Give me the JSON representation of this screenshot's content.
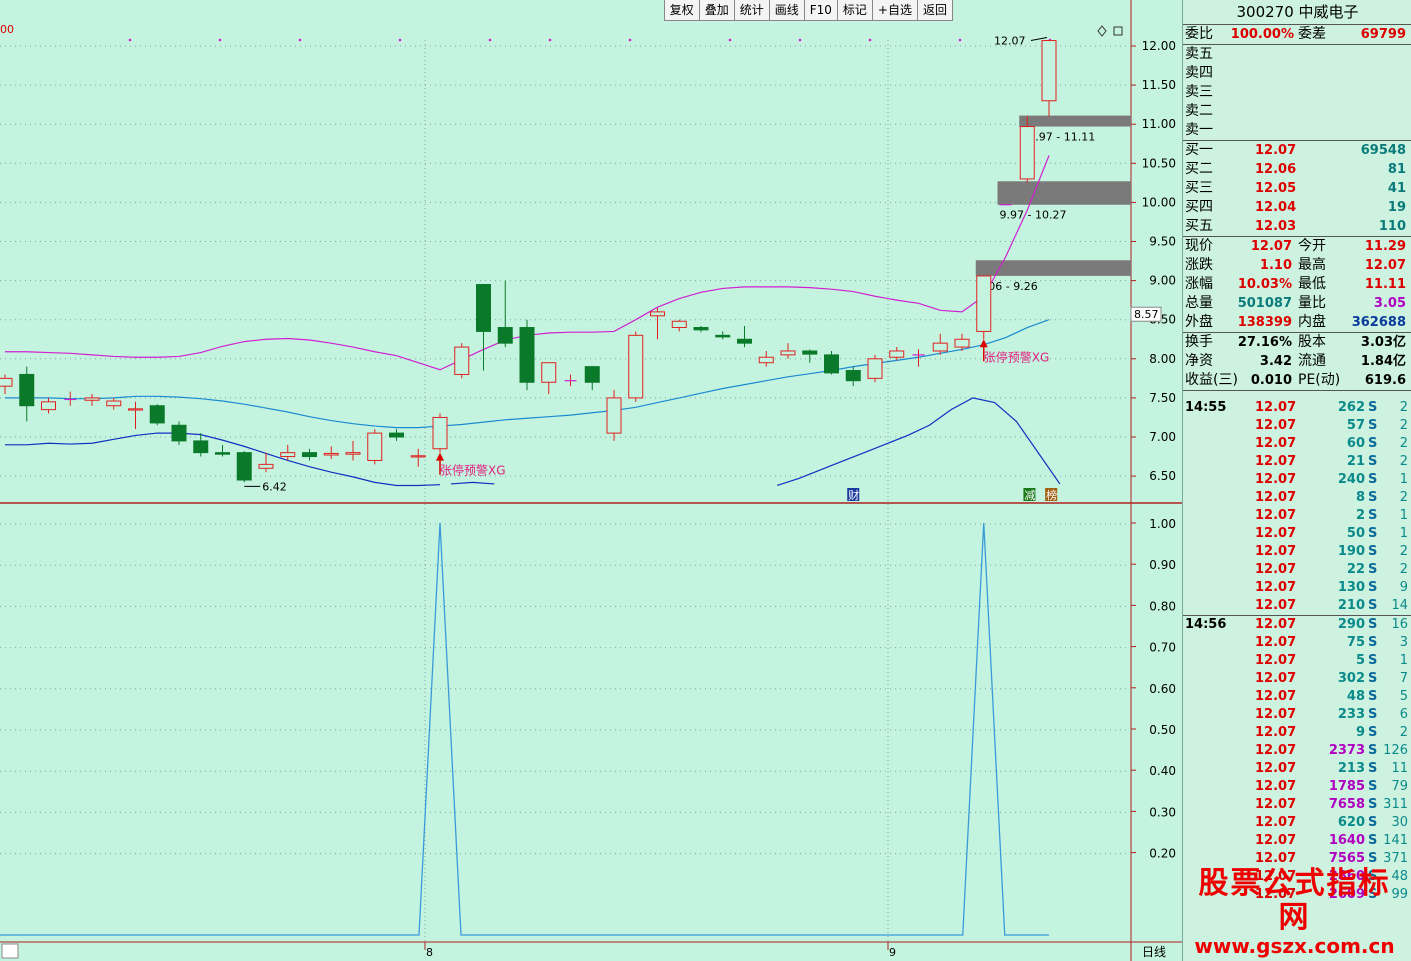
{
  "toolbar": [
    "复权",
    "叠加",
    "统计",
    "画线",
    "F10",
    "标记",
    "+自选",
    "返回"
  ],
  "chart_data": [
    {
      "type": "candlestick",
      "yticks": [
        12.0,
        11.5,
        11.0,
        10.5,
        10.0,
        9.5,
        9.0,
        8.5,
        8.0,
        7.5,
        7.0,
        6.5
      ],
      "ylim": [
        6.2,
        12.2
      ],
      "current_price_label": "8.57",
      "candles": [
        {
          "o": 7.65,
          "h": 7.8,
          "l": 7.55,
          "c": 7.75
        },
        {
          "o": 7.8,
          "h": 7.9,
          "l": 7.2,
          "c": 7.4
        },
        {
          "o": 7.35,
          "h": 7.5,
          "l": 7.3,
          "c": 7.45
        },
        {
          "o": 7.48,
          "h": 7.58,
          "l": 7.4,
          "c": 7.48
        },
        {
          "o": 7.47,
          "h": 7.55,
          "l": 7.4,
          "c": 7.5
        },
        {
          "o": 7.4,
          "h": 7.5,
          "l": 7.35,
          "c": 7.46
        },
        {
          "o": 7.35,
          "h": 7.45,
          "l": 7.1,
          "c": 7.36
        },
        {
          "o": 7.4,
          "h": 7.42,
          "l": 7.15,
          "c": 7.18
        },
        {
          "o": 7.15,
          "h": 7.2,
          "l": 6.9,
          "c": 6.95
        },
        {
          "o": 6.95,
          "h": 7.05,
          "l": 6.75,
          "c": 6.8
        },
        {
          "o": 6.8,
          "h": 6.9,
          "l": 6.75,
          "c": 6.78
        },
        {
          "o": 6.8,
          "h": 6.82,
          "l": 6.42,
          "c": 6.45
        },
        {
          "o": 6.6,
          "h": 6.8,
          "l": 6.55,
          "c": 6.65
        },
        {
          "o": 6.75,
          "h": 6.9,
          "l": 6.7,
          "c": 6.8
        },
        {
          "o": 6.8,
          "h": 6.85,
          "l": 6.7,
          "c": 6.75
        },
        {
          "o": 6.77,
          "h": 6.88,
          "l": 6.72,
          "c": 6.79
        },
        {
          "o": 6.78,
          "h": 6.95,
          "l": 6.7,
          "c": 6.8
        },
        {
          "o": 6.7,
          "h": 7.1,
          "l": 6.65,
          "c": 7.05
        },
        {
          "o": 7.05,
          "h": 7.1,
          "l": 6.95,
          "c": 7.0
        },
        {
          "o": 6.75,
          "h": 6.85,
          "l": 6.62,
          "c": 6.76
        },
        {
          "o": 6.85,
          "h": 7.3,
          "l": 6.8,
          "c": 7.25
        },
        {
          "o": 7.8,
          "h": 8.2,
          "l": 7.75,
          "c": 8.15
        },
        {
          "o": 8.95,
          "h": 8.95,
          "l": 7.85,
          "c": 8.35
        },
        {
          "o": 8.4,
          "h": 9.0,
          "l": 8.15,
          "c": 8.2
        },
        {
          "o": 8.4,
          "h": 8.5,
          "l": 7.6,
          "c": 7.7
        },
        {
          "o": 7.7,
          "h": 7.95,
          "l": 7.55,
          "c": 7.95
        },
        {
          "o": 7.72,
          "h": 7.8,
          "l": 7.65,
          "c": 7.72
        },
        {
          "o": 7.9,
          "h": 7.9,
          "l": 7.6,
          "c": 7.7
        },
        {
          "o": 7.05,
          "h": 7.6,
          "l": 6.95,
          "c": 7.5
        },
        {
          "o": 7.5,
          "h": 8.35,
          "l": 7.45,
          "c": 8.3
        },
        {
          "o": 8.55,
          "h": 8.65,
          "l": 8.25,
          "c": 8.6
        },
        {
          "o": 8.4,
          "h": 8.5,
          "l": 8.35,
          "c": 8.48
        },
        {
          "o": 8.4,
          "h": 8.42,
          "l": 8.34,
          "c": 8.37
        },
        {
          "o": 8.3,
          "h": 8.35,
          "l": 8.25,
          "c": 8.28
        },
        {
          "o": 8.25,
          "h": 8.42,
          "l": 8.15,
          "c": 8.2
        },
        {
          "o": 7.95,
          "h": 8.1,
          "l": 7.9,
          "c": 8.02
        },
        {
          "o": 8.05,
          "h": 8.2,
          "l": 8.0,
          "c": 8.1
        },
        {
          "o": 8.1,
          "h": 8.12,
          "l": 7.95,
          "c": 8.06
        },
        {
          "o": 8.05,
          "h": 8.1,
          "l": 7.8,
          "c": 7.82
        },
        {
          "o": 7.85,
          "h": 7.9,
          "l": 7.65,
          "c": 7.72
        },
        {
          "o": 7.75,
          "h": 8.05,
          "l": 7.7,
          "c": 8.0
        },
        {
          "o": 8.02,
          "h": 8.15,
          "l": 7.98,
          "c": 8.1
        },
        {
          "o": 8.05,
          "h": 8.12,
          "l": 7.9,
          "c": 8.05
        },
        {
          "o": 8.1,
          "h": 8.32,
          "l": 8.05,
          "c": 8.2
        },
        {
          "o": 8.15,
          "h": 8.32,
          "l": 8.1,
          "c": 8.25
        },
        {
          "o": 8.35,
          "h": 9.07,
          "l": 8.25,
          "c": 9.06
        },
        {
          "o": 9.97,
          "h": 9.97,
          "l": 9.97,
          "c": 9.97
        },
        {
          "o": 10.3,
          "h": 11.11,
          "l": 10.25,
          "c": 10.97
        },
        {
          "o": 11.3,
          "h": 12.07,
          "l": 11.1,
          "c": 12.07
        }
      ],
      "boll_upper": [
        8.09,
        8.09,
        8.08,
        8.07,
        8.05,
        8.03,
        8.02,
        8.02,
        8.03,
        8.08,
        8.16,
        8.22,
        8.25,
        8.26,
        8.24,
        8.2,
        8.15,
        8.09,
        8.04,
        7.95,
        7.86,
        7.99,
        8.12,
        8.24,
        8.3,
        8.33,
        8.34,
        8.34,
        8.35,
        8.5,
        8.66,
        8.77,
        8.85,
        8.9,
        8.92,
        8.92,
        8.92,
        8.91,
        8.89,
        8.86,
        8.8,
        8.75,
        8.71,
        8.62,
        8.6,
        8.8,
        9.3,
        9.9,
        10.6
      ],
      "boll_mid": [
        7.5,
        7.5,
        7.5,
        7.49,
        7.49,
        7.5,
        7.52,
        7.52,
        7.51,
        7.49,
        7.46,
        7.42,
        7.37,
        7.32,
        7.26,
        7.21,
        7.17,
        7.14,
        7.12,
        7.12,
        7.14,
        7.16,
        7.19,
        7.22,
        7.24,
        7.26,
        7.28,
        7.31,
        7.34,
        7.38,
        7.44,
        7.5,
        7.56,
        7.62,
        7.67,
        7.72,
        7.77,
        7.81,
        7.85,
        7.9,
        7.94,
        7.98,
        8.02,
        8.07,
        8.12,
        8.18,
        8.27,
        8.4,
        8.5
      ],
      "boll_lower_segments": [
        [
          6.9,
          6.9,
          6.92,
          6.91,
          6.92,
          6.97,
          7.02,
          7.05,
          7.05,
          7.03,
          6.96,
          6.88,
          6.79,
          6.7,
          6.62,
          6.55,
          6.49,
          6.42,
          6.38,
          6.38,
          6.39
        ],
        [
          6.4,
          6.42,
          6.4
        ],
        [
          6.38,
          6.47,
          6.58,
          6.69,
          6.8,
          6.91,
          7.02,
          7.15,
          7.35,
          7.5,
          7.44,
          7.2,
          6.8,
          6.4
        ]
      ],
      "markers": [
        {
          "text": "张停预警XG",
          "candle": 20
        },
        {
          "text": "张停预警XG",
          "candle": 45
        }
      ],
      "gap_zones": [
        {
          "from": 10.97,
          "to": 11.11,
          "label": "10.97 - 11.11"
        },
        {
          "from": 9.97,
          "to": 10.27,
          "label": "9.97 - 10.27"
        },
        {
          "from": 9.06,
          "to": 9.26,
          "label": "9.06 - 9.26"
        }
      ],
      "annotations": {
        "high_label": "12.07",
        "low_label": "6.42"
      },
      "badges": [
        "财",
        "减",
        "榜"
      ],
      "x_labels": [
        "8",
        "9"
      ],
      "corner_label": "00"
    },
    {
      "type": "line",
      "yticks": [
        1.0,
        0.9,
        0.8,
        0.7,
        0.6,
        0.5,
        0.4,
        0.3,
        0.2
      ],
      "ylim": [
        0,
        1
      ],
      "spikes_at_candles": [
        20,
        45
      ]
    }
  ],
  "period_label": "日线",
  "panel": {
    "title": "300270 中威电子",
    "wei_bi": {
      "label": "委比",
      "value": "100.00%"
    },
    "wei_cha": {
      "label": "委差",
      "value": "69799"
    },
    "sells": [
      {
        "label": "卖五",
        "price": "",
        "vol": ""
      },
      {
        "label": "卖四",
        "price": "",
        "vol": ""
      },
      {
        "label": "卖三",
        "price": "",
        "vol": ""
      },
      {
        "label": "卖二",
        "price": "",
        "vol": ""
      },
      {
        "label": "卖一",
        "price": "",
        "vol": ""
      }
    ],
    "buys": [
      {
        "label": "买一",
        "price": "12.07",
        "vol": "69548"
      },
      {
        "label": "买二",
        "price": "12.06",
        "vol": "81"
      },
      {
        "label": "买三",
        "price": "12.05",
        "vol": "41"
      },
      {
        "label": "买四",
        "price": "12.04",
        "vol": "19"
      },
      {
        "label": "买五",
        "price": "12.03",
        "vol": "110"
      }
    ],
    "stats": [
      {
        "l1": "现价",
        "v1": "12.07",
        "l2": "今开",
        "v2": "11.29"
      },
      {
        "l1": "涨跌",
        "v1": "1.10",
        "l2": "最高",
        "v2": "12.07"
      },
      {
        "l1": "涨幅",
        "v1": "10.03%",
        "l2": "最低",
        "v2": "11.11"
      },
      {
        "l1": "总量",
        "v1": "501087",
        "l2": "量比",
        "v2": "3.05"
      },
      {
        "l1": "外盘",
        "v1": "138399",
        "l2": "内盘",
        "v2": "362688"
      }
    ],
    "stats2": [
      {
        "l1": "换手",
        "v1": "27.16%",
        "l2": "股本",
        "v2": "3.03亿"
      },
      {
        "l1": "净资",
        "v1": "3.42",
        "l2": "流通",
        "v2": "1.84亿"
      },
      {
        "l1": "收益(三)",
        "v1": "0.010",
        "l2": "PE(动)",
        "v2": "619.6"
      }
    ],
    "ticks": [
      {
        "time": "14:55",
        "price": "12.07",
        "vol": "262",
        "side": "S",
        "cnt": "2"
      },
      {
        "time": "",
        "price": "12.07",
        "vol": "57",
        "side": "S",
        "cnt": "2"
      },
      {
        "time": "",
        "price": "12.07",
        "vol": "60",
        "side": "S",
        "cnt": "2"
      },
      {
        "time": "",
        "price": "12.07",
        "vol": "21",
        "side": "S",
        "cnt": "2"
      },
      {
        "time": "",
        "price": "12.07",
        "vol": "240",
        "side": "S",
        "cnt": "1"
      },
      {
        "time": "",
        "price": "12.07",
        "vol": "8",
        "side": "S",
        "cnt": "2"
      },
      {
        "time": "",
        "price": "12.07",
        "vol": "2",
        "side": "S",
        "cnt": "1"
      },
      {
        "time": "",
        "price": "12.07",
        "vol": "50",
        "side": "S",
        "cnt": "1"
      },
      {
        "time": "",
        "price": "12.07",
        "vol": "190",
        "side": "S",
        "cnt": "2"
      },
      {
        "time": "",
        "price": "12.07",
        "vol": "22",
        "side": "S",
        "cnt": "2"
      },
      {
        "time": "",
        "price": "12.07",
        "vol": "130",
        "side": "S",
        "cnt": "9"
      },
      {
        "time": "",
        "price": "12.07",
        "vol": "210",
        "side": "S",
        "cnt": "14"
      },
      {
        "time": "14:56",
        "price": "12.07",
        "vol": "290",
        "side": "S",
        "cnt": "16"
      },
      {
        "time": "",
        "price": "12.07",
        "vol": "75",
        "side": "S",
        "cnt": "3"
      },
      {
        "time": "",
        "price": "12.07",
        "vol": "5",
        "side": "S",
        "cnt": "1"
      },
      {
        "time": "",
        "price": "12.07",
        "vol": "302",
        "side": "S",
        "cnt": "7"
      },
      {
        "time": "",
        "price": "12.07",
        "vol": "48",
        "side": "S",
        "cnt": "5"
      },
      {
        "time": "",
        "price": "12.07",
        "vol": "233",
        "side": "S",
        "cnt": "6"
      },
      {
        "time": "",
        "price": "12.07",
        "vol": "9",
        "side": "S",
        "cnt": "2"
      },
      {
        "time": "",
        "price": "12.07",
        "vol": "2373",
        "side": "S",
        "cnt": "126"
      },
      {
        "time": "",
        "price": "12.07",
        "vol": "213",
        "side": "S",
        "cnt": "11"
      },
      {
        "time": "",
        "price": "12.07",
        "vol": "1785",
        "side": "S",
        "cnt": "79"
      },
      {
        "time": "",
        "price": "12.07",
        "vol": "7658",
        "side": "S",
        "cnt": "311"
      },
      {
        "time": "",
        "price": "12.07",
        "vol": "620",
        "side": "S",
        "cnt": "30"
      },
      {
        "time": "",
        "price": "12.07",
        "vol": "1640",
        "side": "S",
        "cnt": "141"
      },
      {
        "time": "",
        "price": "12.07",
        "vol": "7565",
        "side": "S",
        "cnt": "371"
      },
      {
        "time": "",
        "price": "12.07",
        "vol": "2860",
        "side": "S",
        "cnt": "48"
      },
      {
        "time": "",
        "price": "12.07",
        "vol": "2609",
        "side": "S",
        "cnt": "99"
      }
    ]
  },
  "watermark": {
    "cn": "股票公式指标网",
    "url": "www.gszx.com.cn"
  },
  "colors": {
    "bg": "#c4f4e0",
    "up": "#e0201e",
    "down": "#0a7a2a",
    "boll_upper": "#d020d0",
    "boll_mid": "#1a8ad0",
    "boll_lower": "#1030c0",
    "gap": "#7a7a7a",
    "indicator": "#3a9ad8",
    "marker": "#e02080"
  }
}
